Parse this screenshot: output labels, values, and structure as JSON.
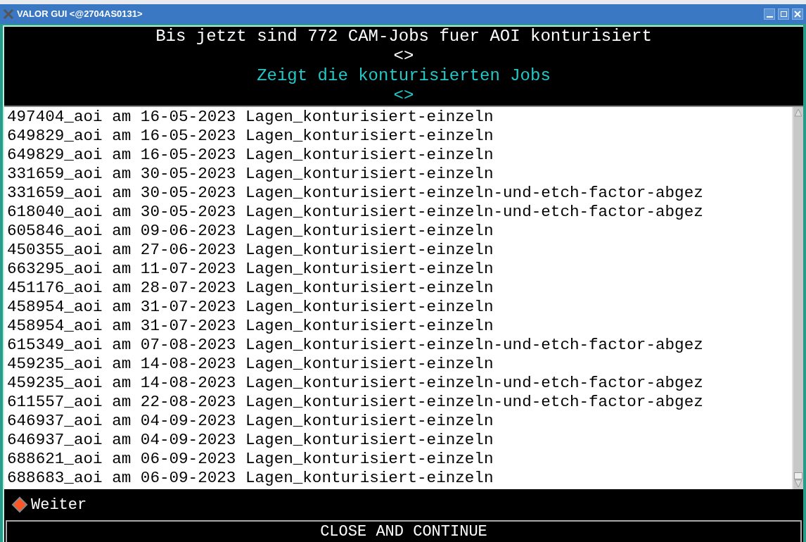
{
  "window": {
    "title": "VALOR GUI <@2704AS0131>"
  },
  "header": {
    "lines": [
      {
        "text": "Bis jetzt sind 772 CAM-Jobs fuer AOI konturisiert",
        "kind": "plain"
      },
      {
        "text": "<>",
        "kind": "plain"
      },
      {
        "text": "Zeigt die konturisierten Jobs",
        "kind": "accent"
      },
      {
        "text": "<>",
        "kind": "accent"
      }
    ]
  },
  "jobs": [
    "497404_aoi am 16-05-2023 Lagen_konturisiert-einzeln",
    "649829_aoi am 16-05-2023 Lagen_konturisiert-einzeln",
    "649829_aoi am 16-05-2023 Lagen_konturisiert-einzeln",
    "331659_aoi am 30-05-2023 Lagen_konturisiert-einzeln",
    "331659_aoi am 30-05-2023 Lagen_konturisiert-einzeln-und-etch-factor-abgez",
    "618040_aoi am 30-05-2023 Lagen_konturisiert-einzeln-und-etch-factor-abgez",
    "605846_aoi am 09-06-2023 Lagen_konturisiert-einzeln",
    "450355_aoi am 27-06-2023 Lagen_konturisiert-einzeln",
    "663295_aoi am 11-07-2023 Lagen_konturisiert-einzeln",
    "451176_aoi am 28-07-2023 Lagen_konturisiert-einzeln",
    "458954_aoi am 31-07-2023 Lagen_konturisiert-einzeln",
    "458954_aoi am 31-07-2023 Lagen_konturisiert-einzeln",
    "615349_aoi am 07-08-2023 Lagen_konturisiert-einzeln-und-etch-factor-abgez",
    "459235_aoi am 14-08-2023 Lagen_konturisiert-einzeln",
    "459235_aoi am 14-08-2023 Lagen_konturisiert-einzeln-und-etch-factor-abgez",
    "611557_aoi am 22-08-2023 Lagen_konturisiert-einzeln-und-etch-factor-abgez",
    "646937_aoi am 04-09-2023 Lagen_konturisiert-einzeln",
    "646937_aoi am 04-09-2023 Lagen_konturisiert-einzeln",
    "688621_aoi am 06-09-2023 Lagen_konturisiert-einzeln",
    "688683_aoi am 06-09-2023 Lagen_konturisiert-einzeln"
  ],
  "option": {
    "label": "Weiter",
    "selected": true
  },
  "button": {
    "label": "CLOSE AND CONTINUE"
  }
}
